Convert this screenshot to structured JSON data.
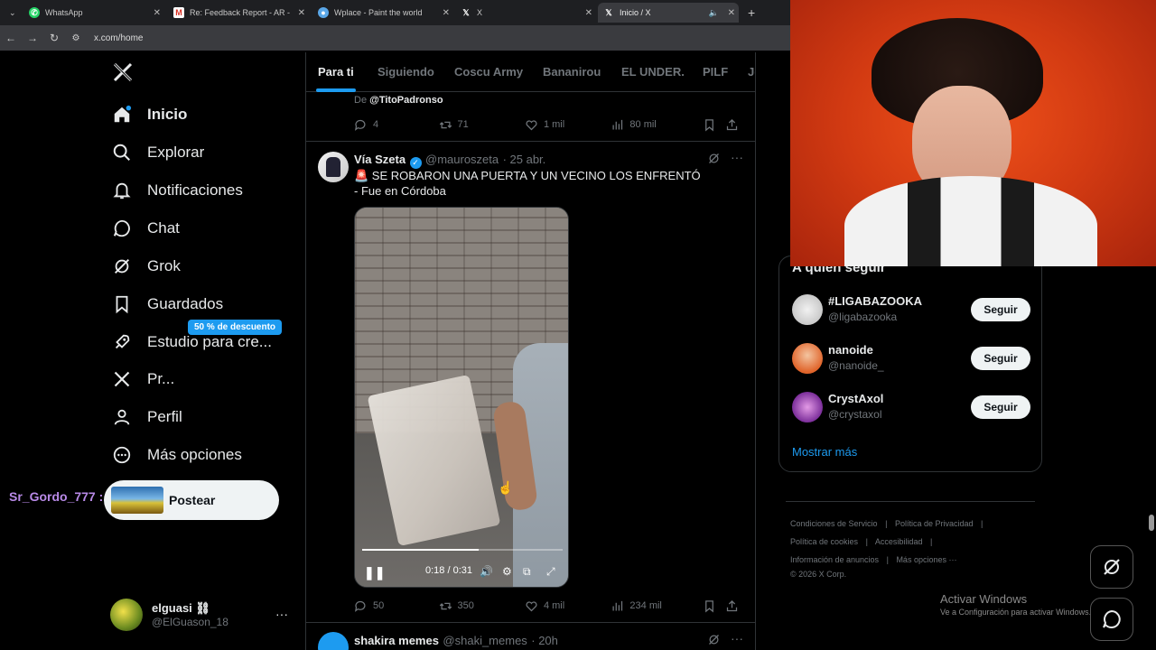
{
  "browser": {
    "tabs": [
      {
        "label": "WhatsApp"
      },
      {
        "label": "Re: Feedback Report - AR - mai"
      },
      {
        "label": "Wplace - Paint the world"
      },
      {
        "label": "X"
      },
      {
        "label": "Inicio / X"
      }
    ],
    "url": "x.com/home"
  },
  "sidebar": {
    "logo": "X",
    "items": [
      {
        "label": "Inicio",
        "icon": "home-icon"
      },
      {
        "label": "Explorar",
        "icon": "search-icon"
      },
      {
        "label": "Notificaciones",
        "icon": "bell-icon"
      },
      {
        "label": "Chat",
        "icon": "chat-bubble-icon"
      },
      {
        "label": "Grok",
        "icon": "grok-icon"
      },
      {
        "label": "Guardados",
        "icon": "bookmark-icon"
      },
      {
        "label": "Estudio para cre...",
        "icon": "rocket-icon"
      },
      {
        "label": "Pr...",
        "icon": "x-logo-icon"
      },
      {
        "label": "Perfil",
        "icon": "person-icon"
      },
      {
        "label": "Más opciones",
        "icon": "more-circle-icon"
      }
    ],
    "promo_badge": "50 % de descuento",
    "post_button": "Postear",
    "chat_overlay_user": "Sr_Gordo_777 :",
    "profile": {
      "name": "elguasi ⛓",
      "handle": "@ElGuason_18",
      "more": "···"
    }
  },
  "feed": {
    "tabs": [
      "Para ti",
      "Siguiendo",
      "Coscu Army",
      "Bananirou",
      "EL UNDER.",
      "PILF",
      "J("
    ],
    "prev_tweet": {
      "from_prefix": "De",
      "from_handle": "@TitoPadronso",
      "replies": "4",
      "reposts": "71",
      "likes": "1 mil",
      "views": "80 mil"
    },
    "tweet": {
      "name": "Vía Szeta",
      "handle": "@mauroszeta",
      "time": "· 25 abr.",
      "line1": "🚨 SE ROBARON UNA PUERTA Y UN VECINO LOS ENFRENTÓ",
      "line2": "- Fue en Córdoba",
      "video_time": "0:18 / 0:31",
      "video_progress": 0.58,
      "replies": "50",
      "reposts": "350",
      "likes": "4 mil",
      "views": "234 mil"
    },
    "next_tweet": {
      "name": "shakira memes",
      "handle": "@shaki_memes",
      "time": "· 20h"
    }
  },
  "right": {
    "follow_title": "A quién seguir",
    "suggestions": [
      {
        "name": "#LIGABAZOOKA",
        "handle": "@ligabazooka",
        "button": "Seguir"
      },
      {
        "name": "nanoide",
        "handle": "@nanoide_",
        "button": "Seguir"
      },
      {
        "name": "CrystAxol",
        "handle": "@crystaxol",
        "button": "Seguir"
      }
    ],
    "show_more": "Mostrar más",
    "footer": {
      "terms": "Condiciones de Servicio",
      "privacy": "Política de Privacidad",
      "cookies": "Política de cookies",
      "accessibility": "Accesibilidad",
      "ads": "Información de anuncios",
      "more": "Más opciones ···",
      "copyright": "© 2026 X Corp."
    }
  },
  "windows_watermark": {
    "title": "Activar Windows",
    "subtitle": "Ve a Configuración para activar Windows."
  },
  "colors": {
    "accent": "#1d9bf0",
    "background": "#000000",
    "border": "#2f3336",
    "muted": "#71767b",
    "chat_user": "#b98ae8"
  }
}
